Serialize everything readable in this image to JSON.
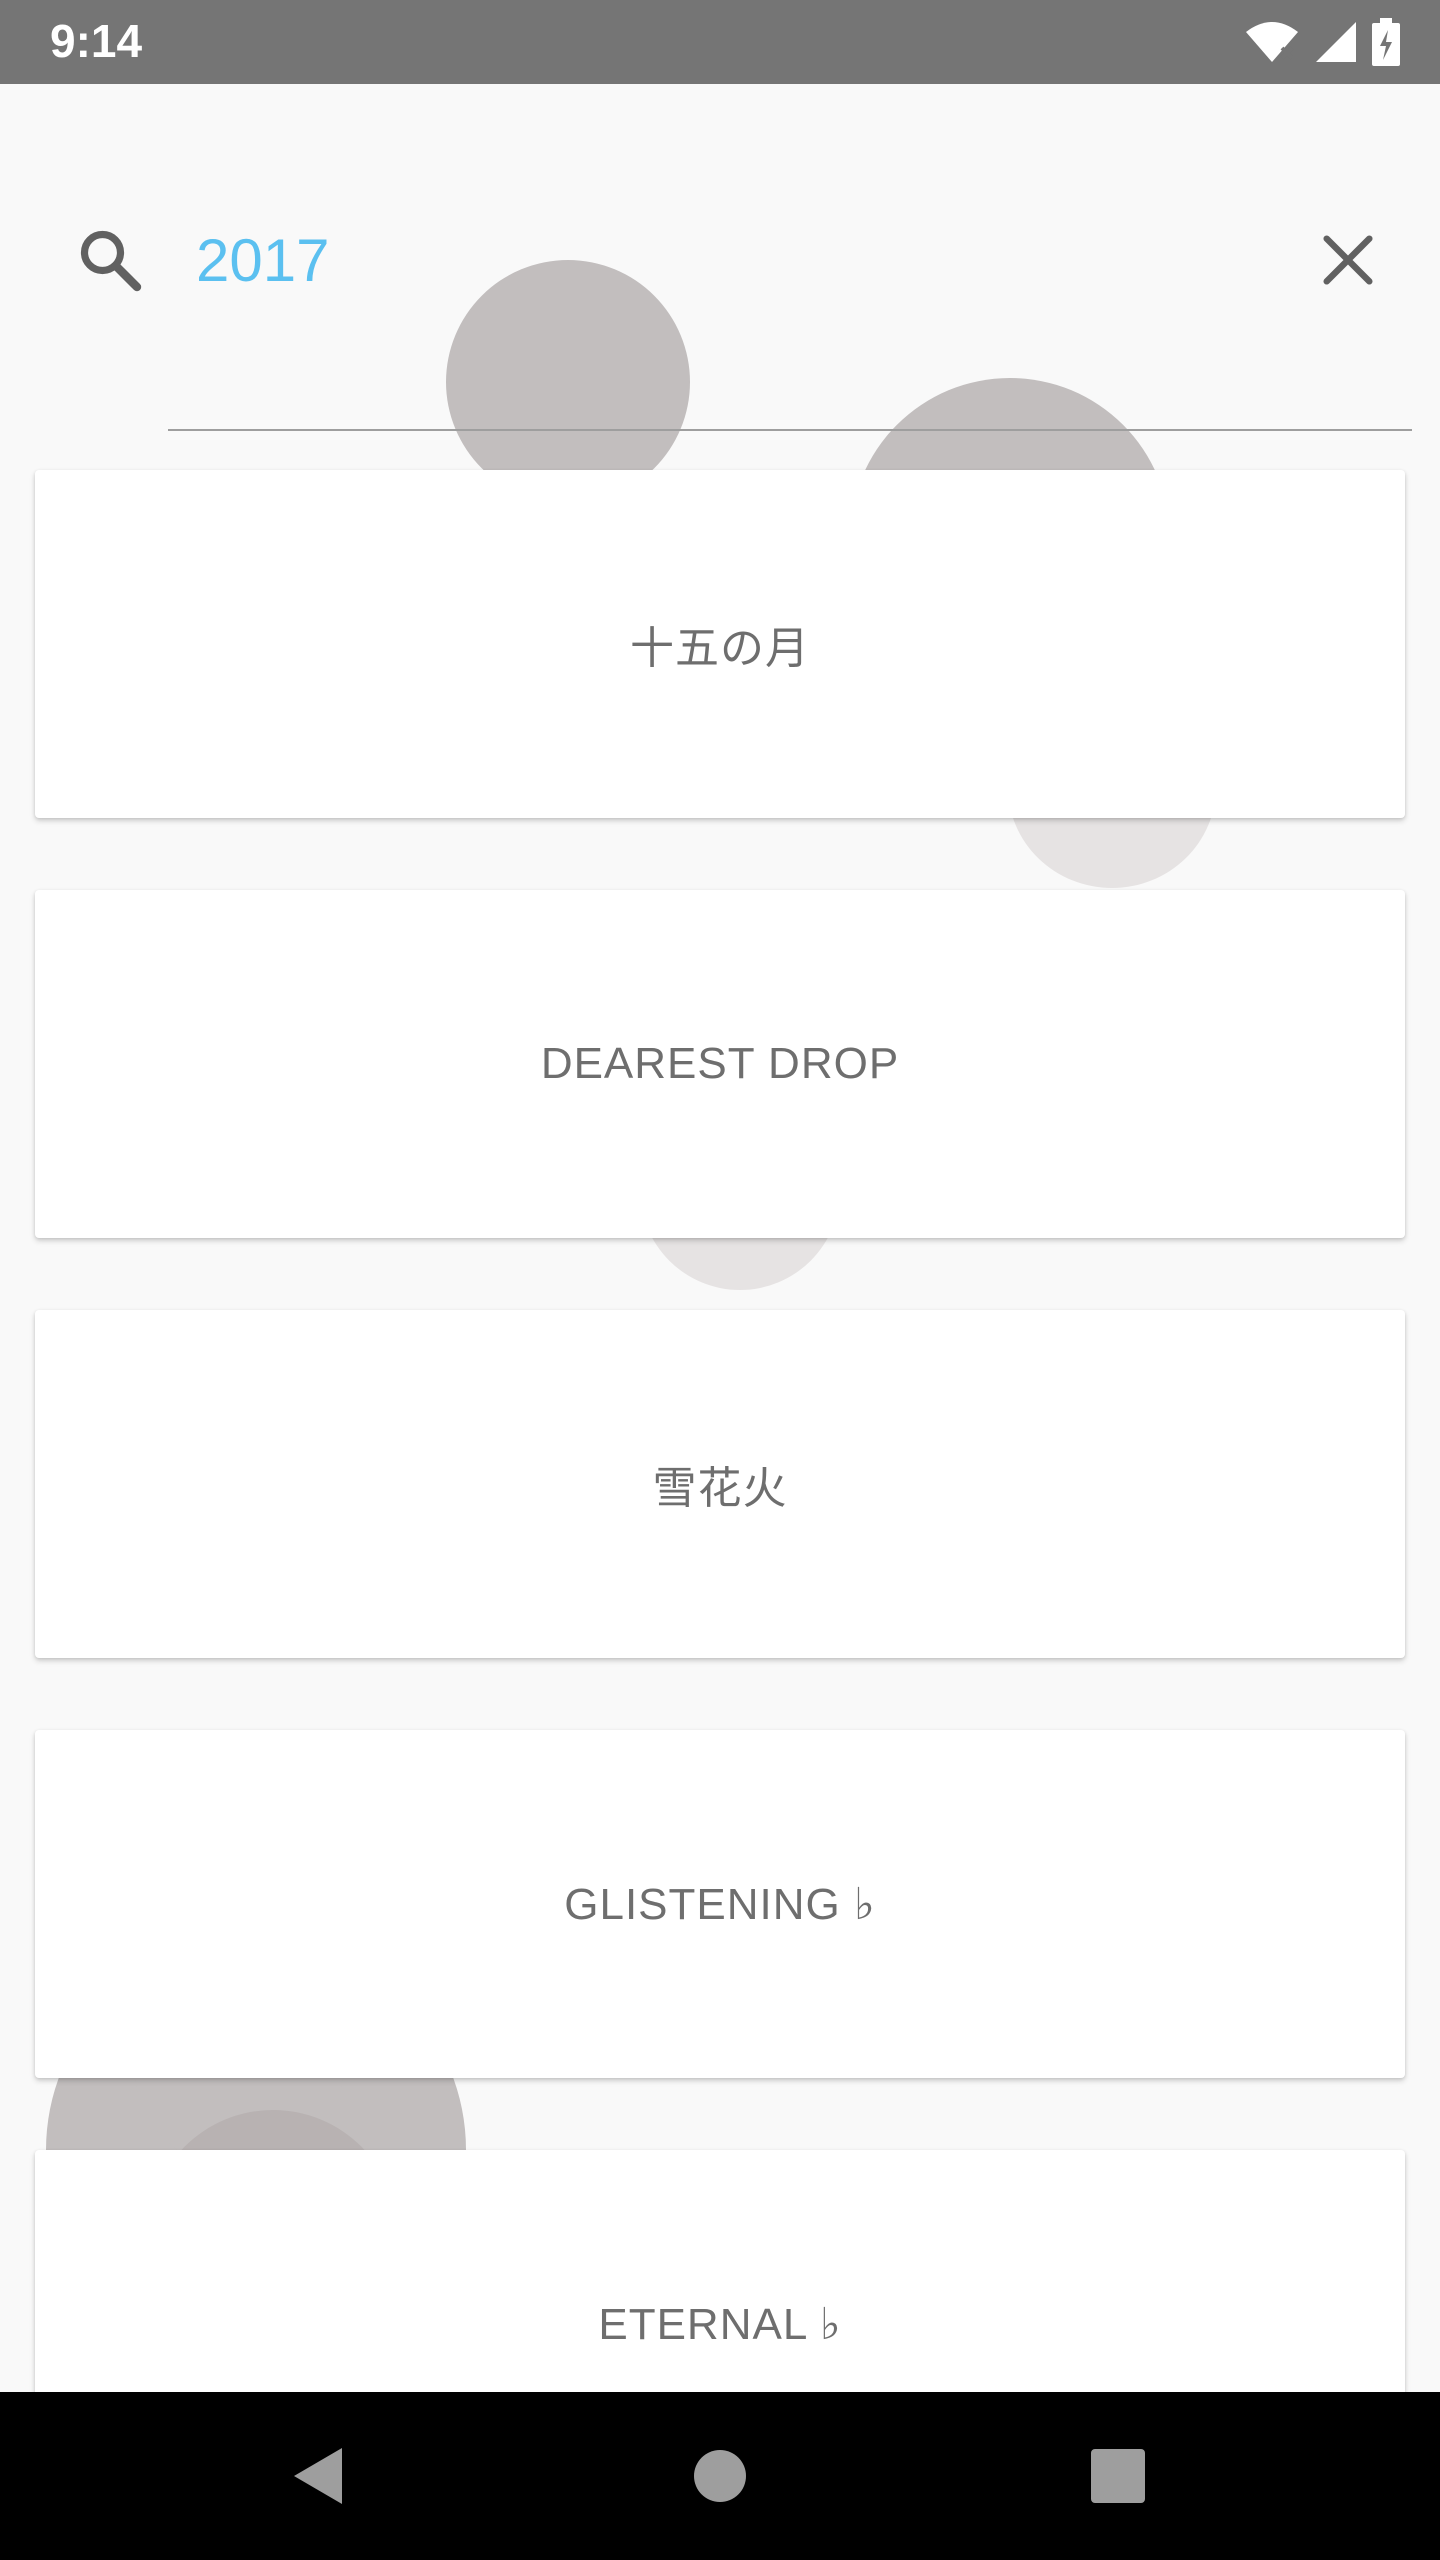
{
  "status_bar": {
    "time": "9:14"
  },
  "search": {
    "query": "2017",
    "placeholder": ""
  },
  "results": [
    {
      "title": "十五の月"
    },
    {
      "title": "DEAREST DROP"
    },
    {
      "title": "雪花火"
    },
    {
      "title": "GLISTENING ♭"
    },
    {
      "title": "ETERNAL ♭"
    }
  ],
  "colors": {
    "accent": "#5bc0f0",
    "status_bar": "#757575",
    "background": "#f9f9f9",
    "bubble": "#c2bebe",
    "card_text": "#6e6e6e"
  },
  "icons": {
    "search": "search-icon",
    "clear": "close-icon",
    "nav_back": "back-triangle-icon",
    "nav_home": "home-circle-icon",
    "nav_recents": "recents-square-icon"
  }
}
